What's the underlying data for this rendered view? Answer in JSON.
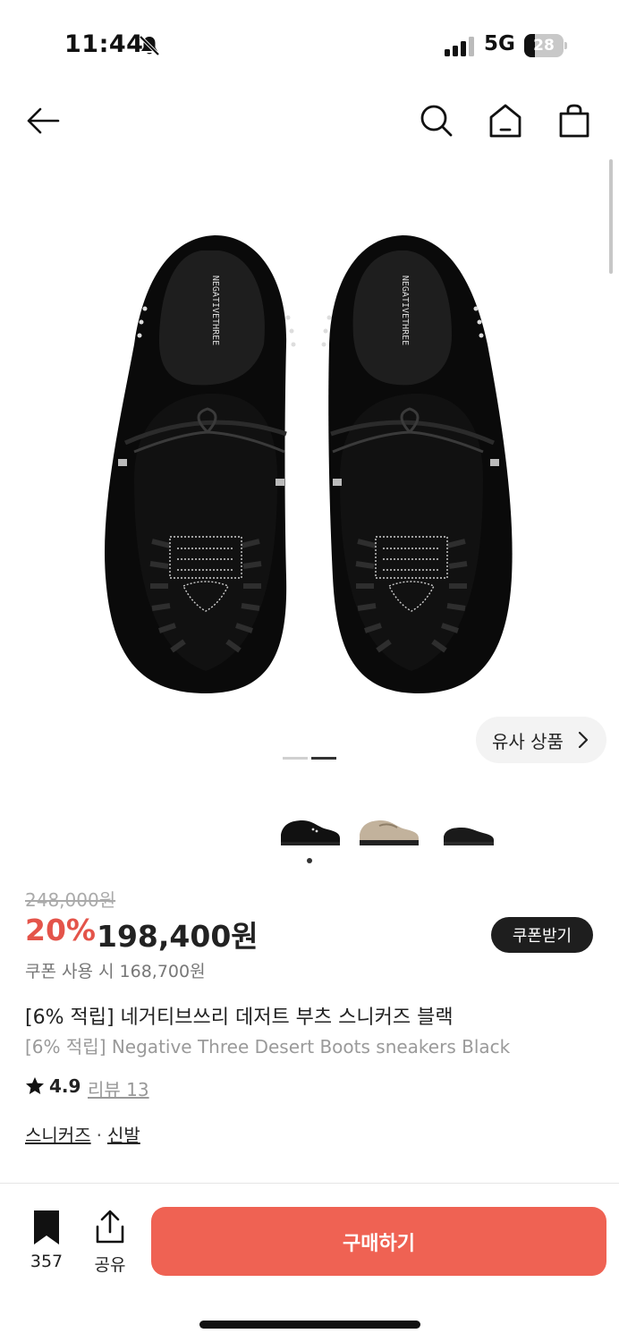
{
  "status_bar": {
    "time": "11:44",
    "network": "5G",
    "battery": "28"
  },
  "nav": {
    "icons": [
      "back-arrow-icon",
      "search-icon",
      "home-icon",
      "shopping-bag-icon"
    ]
  },
  "gallery": {
    "similar_label": "유사 상품",
    "page_count": 2,
    "current_page": 2
  },
  "variants": {
    "colors": [
      "black",
      "beige",
      "black-low"
    ],
    "selected": 0
  },
  "price": {
    "original": "248,000원",
    "discount": "20%",
    "sale": "198,400원",
    "coupon_button": "쿠폰받기",
    "coupon_price": "쿠폰 사용 시 168,700원"
  },
  "product": {
    "title": "[6% 적립] 네거티브쓰리 데저트 부츠 스니커즈 블랙",
    "subtitle": "[6% 적립] Negative Three Desert Boots sneakers Black",
    "rating": "4.9",
    "reviews": "리뷰 13",
    "category_1": "스니커즈",
    "separator": "·",
    "category_2": "신발",
    "print_text": "NEGATIVETHREE"
  },
  "bottom_bar": {
    "save_count": "357",
    "share_label": "공유",
    "buy_label": "구매하기"
  },
  "colors": {
    "accent": "#ef6253",
    "discount": "#e4544a",
    "dark_button": "#1e1e1e"
  }
}
